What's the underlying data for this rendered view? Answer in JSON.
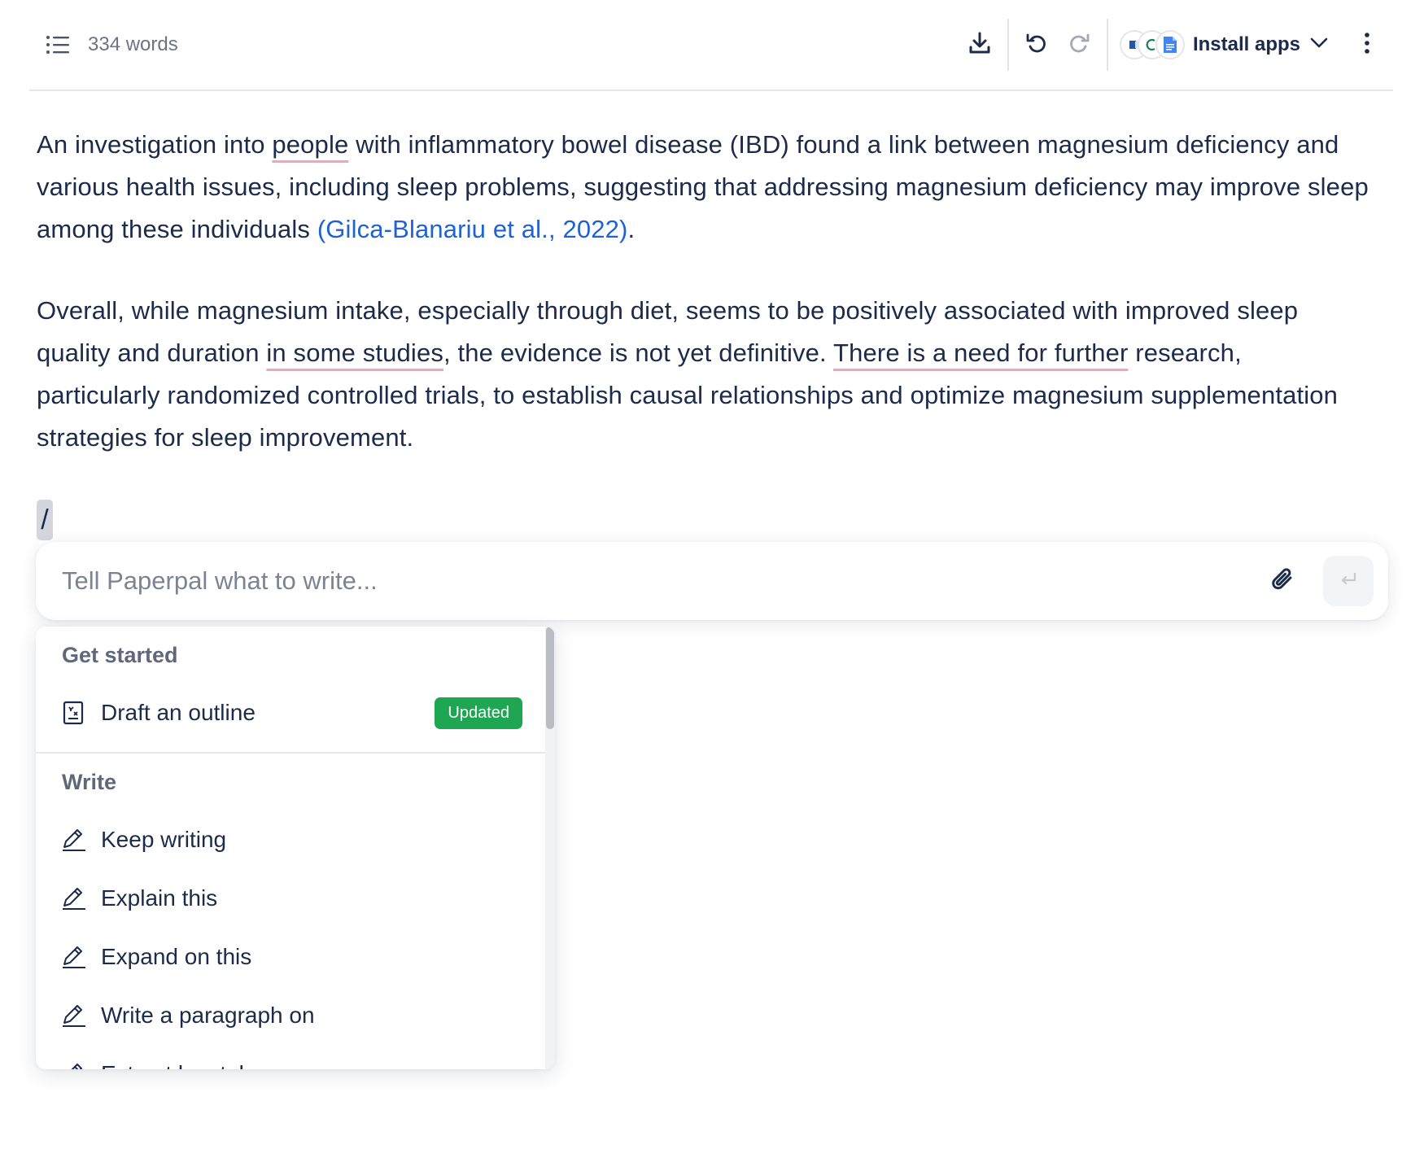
{
  "toolbar": {
    "word_count": "334 words",
    "install_label": "Install apps",
    "icons": [
      "outline-list-icon",
      "download-icon",
      "undo-icon",
      "redo-icon",
      "word-app-icon",
      "paperpal-app-icon",
      "google-docs-icon",
      "chevron-down-icon",
      "more-vertical-icon"
    ]
  },
  "document": {
    "p1": {
      "s1": "An investigation into ",
      "s2": "people",
      "s3": " with inflammatory bowel disease (IBD) found a link between magnesium deficiency and various health issues, including sleep problems, suggesting that addressing magnesium deficiency may improve sleep among these individuals ",
      "citation": "(Gilca-Blanariu et al., 2022)",
      "s4": "."
    },
    "p2": {
      "s1": "Overall, while magnesium intake, especially through diet, seems to be positively associated with improved sleep quality and duration ",
      "s2": "in some studies",
      "s3": ", the evidence is not yet definitive. ",
      "s4": "There is a need for further",
      "s5": " research, particularly randomized controlled trials, to establish causal relationships and optimize magnesium supplementation strategies for sleep improvement."
    },
    "slash": "/"
  },
  "prompt": {
    "placeholder": "Tell Paperpal what to write...",
    "value": ""
  },
  "menu": {
    "sections": [
      {
        "title": "Get started",
        "items": [
          {
            "label": "Draft an outline",
            "icon": "outline-doc-icon",
            "badge": "Updated"
          }
        ]
      },
      {
        "title": "Write",
        "items": [
          {
            "label": "Keep writing",
            "icon": "pencil-icon"
          },
          {
            "label": "Explain this",
            "icon": "pencil-icon"
          },
          {
            "label": "Expand on this",
            "icon": "pencil-icon"
          },
          {
            "label": "Write a paragraph on",
            "icon": "pencil-icon"
          },
          {
            "label": "Extract key takeaways",
            "icon": "pencil-icon"
          }
        ]
      }
    ]
  },
  "colors": {
    "text": "#1c2b4a",
    "citation": "#1f62d1",
    "squiggle": "#f1a6b8",
    "badge": "#1fa652"
  }
}
